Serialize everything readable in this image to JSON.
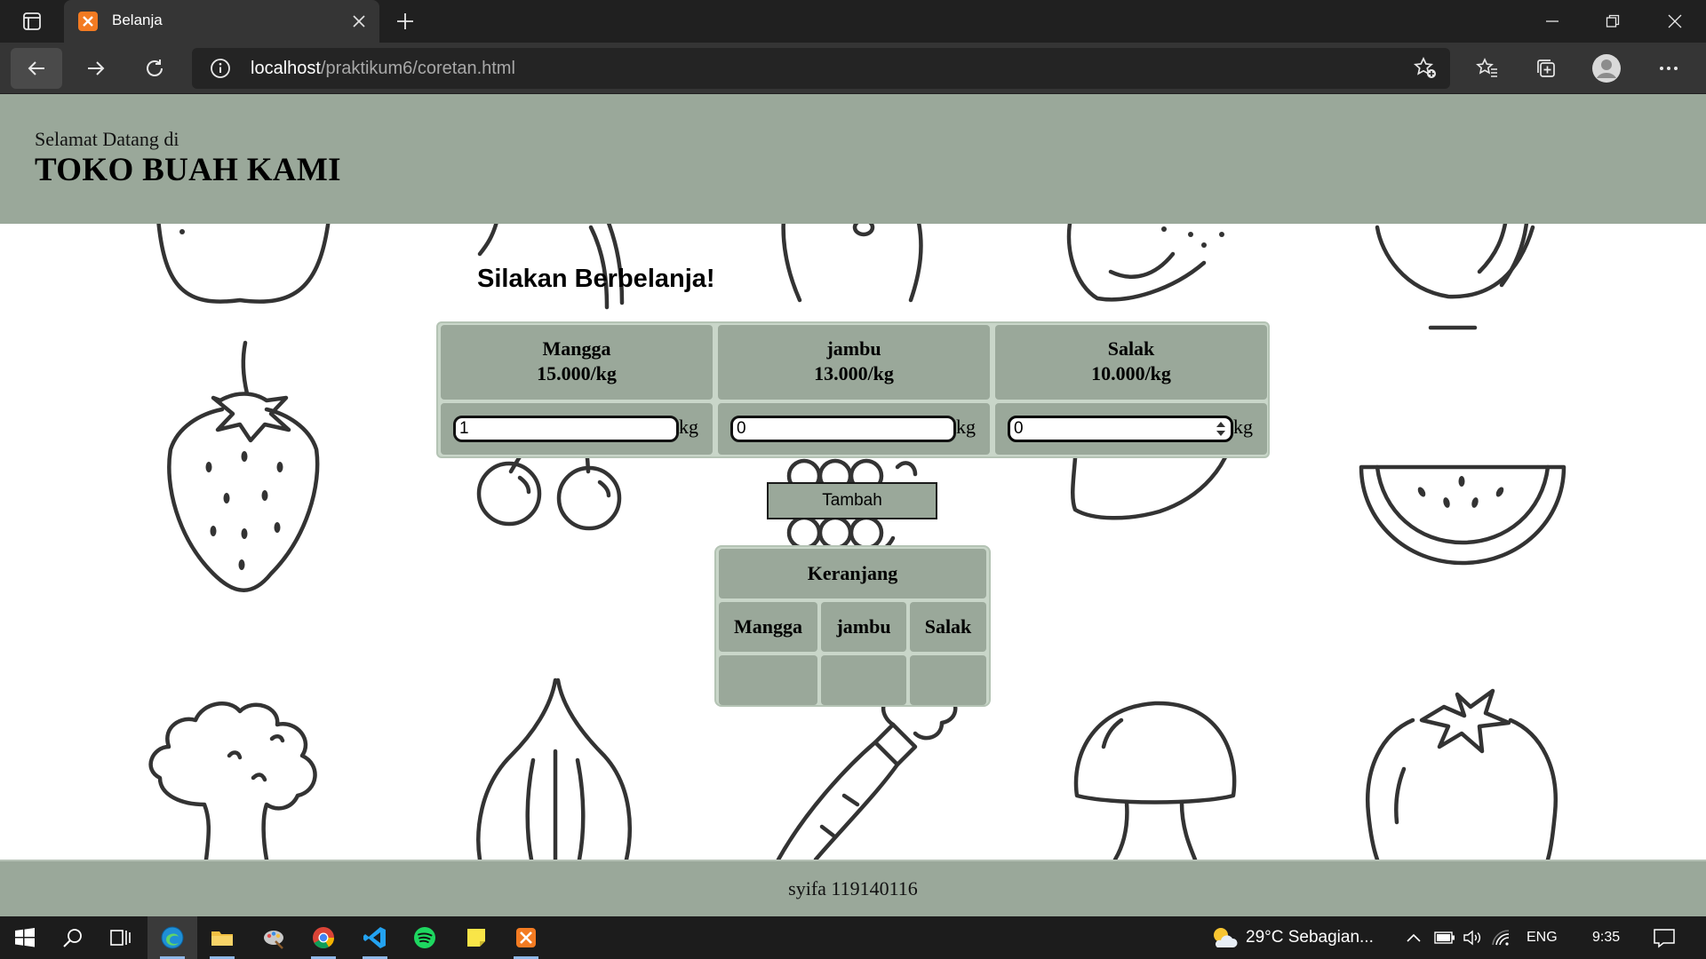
{
  "browser": {
    "tab_title": "Belanja",
    "tab_favicon": "XAMPP",
    "url_host": "localhost",
    "url_path": "/praktikum6/coretan.html"
  },
  "page": {
    "welcome": "Selamat Datang di",
    "shop_name": "TOKO BUAH KAMI",
    "heading": "Silakan Berbelanja!",
    "products": [
      {
        "name": "Mangga",
        "price": "15.000/kg",
        "quantity": "1",
        "unit": "kg"
      },
      {
        "name": "jambu",
        "price": "13.000/kg",
        "quantity": "0",
        "unit": "kg"
      },
      {
        "name": "Salak",
        "price": "10.000/kg",
        "quantity": "0",
        "unit": "kg"
      }
    ],
    "add_button": "Tambah",
    "cart": {
      "title": "Keranjang",
      "columns": [
        "Mangga",
        "jambu",
        "Salak"
      ],
      "values": [
        "",
        "",
        ""
      ]
    },
    "footer": "syifa 119140116"
  },
  "taskbar": {
    "weather": "29°C  Sebagian...",
    "language": "ENG",
    "time": "9:35"
  },
  "colors": {
    "header_bg": "#9aa89a",
    "panel_bg": "#c9d6c9",
    "chrome_dark": "#202020",
    "chrome_mid": "#353535"
  }
}
